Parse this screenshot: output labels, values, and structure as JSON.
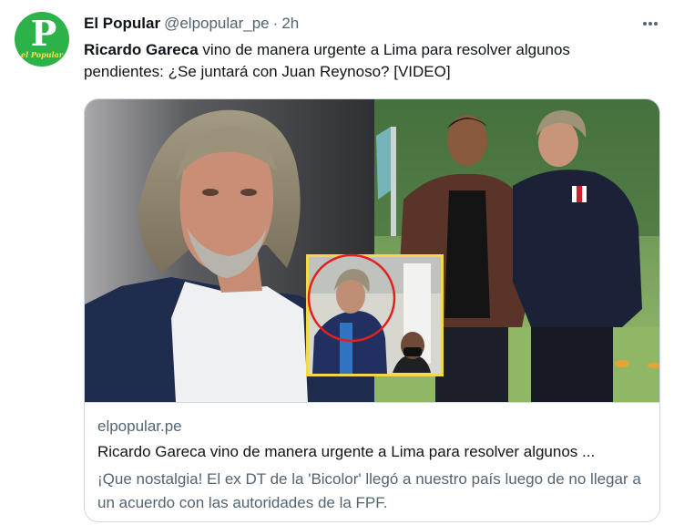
{
  "tweet": {
    "avatar": {
      "letter": "P",
      "brand": "el Popular",
      "bg_color": "#2bb34a"
    },
    "display_name": "El Popular",
    "handle": "@elpopular_pe",
    "separator": "·",
    "time": "2h",
    "more_icon": "more-horizontal-icon",
    "text_bold": "Ricardo Gareca",
    "text_rest": " vino de manera urgente a Lima para resolver algunos pendientes: ¿Se juntará con Juan Reynoso? [VIDEO]",
    "card": {
      "domain": "elpopular.pe",
      "title": "Ricardo Gareca vino de manera urgente a Lima para resolver algunos ...",
      "description": "¡Que nostalgia! El ex DT de la 'Bicolor' llegó a nuestro país luego de no llegar a un acuerdo con las autoridades de la FPF."
    }
  },
  "colors": {
    "text_primary": "#0f1419",
    "text_secondary": "#536471",
    "border": "#cfd9de",
    "inset_frame": "#f3d84a",
    "highlight_circle": "#e0211f"
  }
}
